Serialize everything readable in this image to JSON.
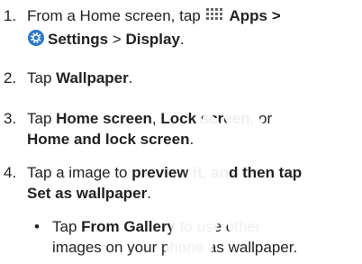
{
  "steps": [
    {
      "num": "1.",
      "line1": {
        "pre": "From a Home screen, tap ",
        "apps": "Apps",
        "gt1": " >"
      },
      "line2": {
        "settings": "Settings",
        "gt2": " > ",
        "display": "Display",
        "end": "."
      }
    },
    {
      "num": "2.",
      "pre": "Tap ",
      "bold": "Wallpaper",
      "end": "."
    },
    {
      "num": "3.",
      "line1": {
        "pre": "Tap ",
        "b1": "Home screen",
        "sep1": ", ",
        "b2": "Lock screen",
        "sep2": ", or"
      },
      "line2": {
        "b3": "Home and lock screen",
        "end": "."
      }
    },
    {
      "num": "4.",
      "line1": {
        "pre": "Tap a image to ",
        "b1": "preview it",
        "mid": ", ",
        "b2": "and then tap"
      },
      "line2": {
        "b3": "Set as wallpaper",
        "end": "."
      }
    }
  ],
  "bullet": {
    "dot": "•",
    "line1": {
      "pre": "Tap ",
      "bold": "From Gallery",
      "post": " to use other"
    },
    "line2": "images on your phone as wallpaper."
  },
  "icons": {
    "apps": "apps-grid-icon",
    "settings": "settings-gear-icon"
  },
  "colors": {
    "settings_icon": "#2a78c8",
    "apps_icon": "#555555",
    "watermark": "#ffffff"
  }
}
